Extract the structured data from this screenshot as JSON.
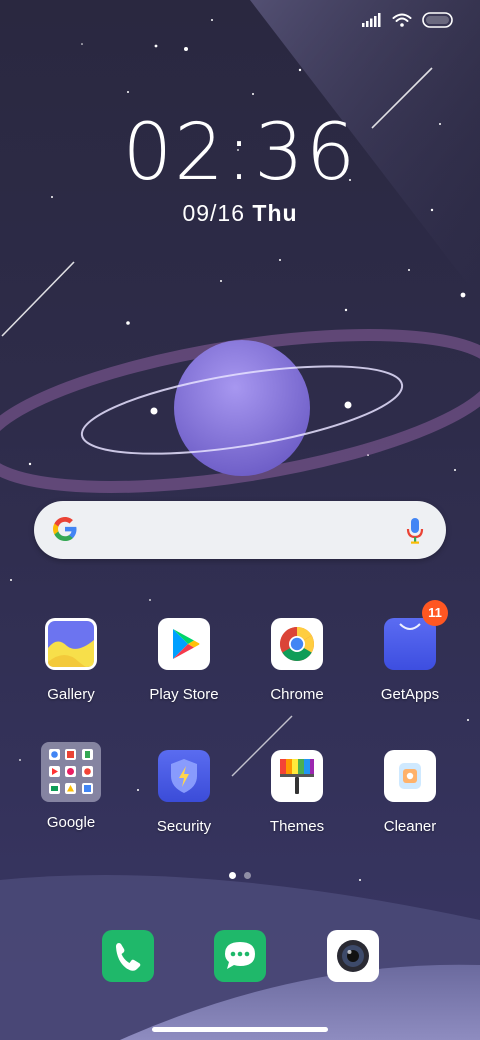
{
  "status": {
    "signal_icon": "signal-icon",
    "wifi_icon": "wifi-icon",
    "battery_icon": "battery-icon"
  },
  "clock": {
    "time": "02:36",
    "date": "09/16",
    "weekday": "Thu"
  },
  "search": {
    "logo_icon": "google-g-icon",
    "mic_icon": "mic-icon"
  },
  "apps": [
    {
      "label": "Gallery",
      "icon": "gallery-icon"
    },
    {
      "label": "Play Store",
      "icon": "play-store-icon"
    },
    {
      "label": "Chrome",
      "icon": "chrome-icon"
    },
    {
      "label": "GetApps",
      "icon": "getapps-icon",
      "badge": "11"
    },
    {
      "label": "Google",
      "icon": "google-folder-icon"
    },
    {
      "label": "Security",
      "icon": "security-icon"
    },
    {
      "label": "Themes",
      "icon": "themes-icon"
    },
    {
      "label": "Cleaner",
      "icon": "cleaner-icon"
    }
  ],
  "pages": {
    "count": 2,
    "current": 1
  },
  "dock": [
    {
      "icon": "phone-icon"
    },
    {
      "icon": "messages-icon"
    },
    {
      "icon": "camera-icon"
    }
  ],
  "colors": {
    "badge": "#ff5722",
    "phone_green": "#1fb86a"
  }
}
